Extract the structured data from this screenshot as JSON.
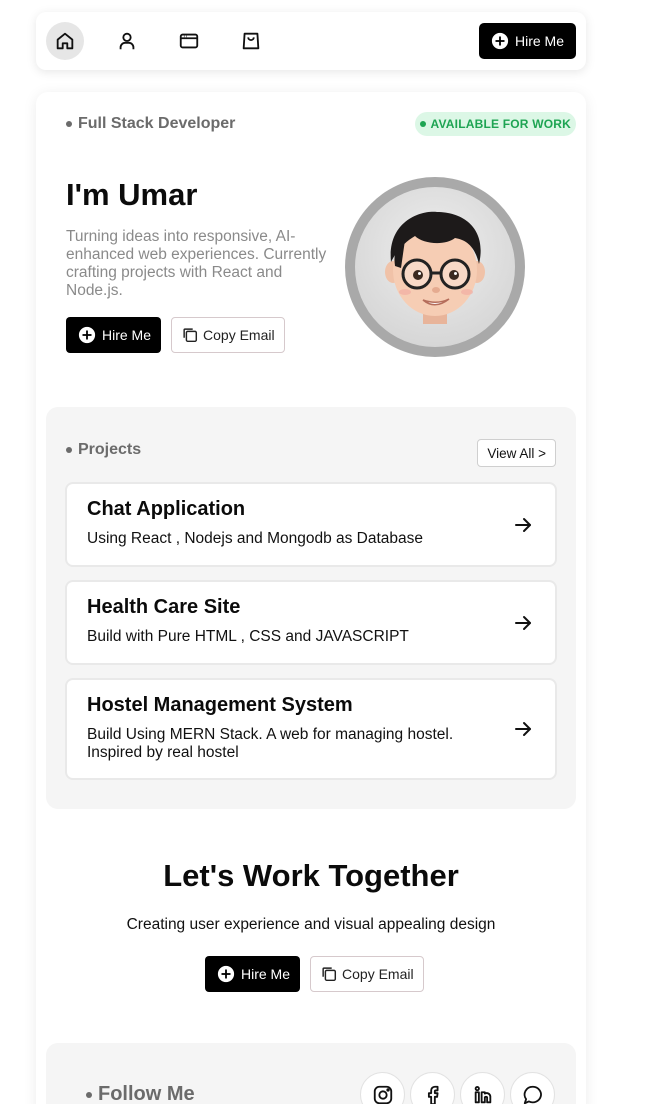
{
  "nav": {
    "icons": [
      "home-icon",
      "user-icon",
      "browser-window-icon",
      "shopping-bag-icon"
    ],
    "hire_label": "Hire Me"
  },
  "hero": {
    "role": "Full Stack Developer",
    "availability": "AVAILABLE FOR WORK",
    "title": "I'm Umar",
    "description": "Turning ideas into responsive, AI-enhanced web experiences. Currently crafting projects with React and Node.js.",
    "hire_label": "Hire Me",
    "copy_label": "Copy Email"
  },
  "projects": {
    "heading": "Projects",
    "view_all": "View All >",
    "items": [
      {
        "title": "Chat Application",
        "description": "Using React , Nodejs and Mongodb as Database"
      },
      {
        "title": "Health Care Site",
        "description": "Build with Pure HTML , CSS and JAVASCRIPT"
      },
      {
        "title": "Hostel Management System",
        "description": "Build Using MERN Stack. A web for managing hostel. Inspired by real hostel"
      }
    ]
  },
  "work": {
    "title": "Let's Work Together",
    "subtitle": "Creating user experience and visual appealing design",
    "hire_label": "Hire Me",
    "copy_label": "Copy Email"
  },
  "follow": {
    "heading": "Follow Me",
    "socials": [
      "instagram-icon",
      "facebook-icon",
      "linkedin-icon",
      "chat-icon"
    ]
  },
  "colors": {
    "accent_dark": "#000000",
    "available_bg": "#dcf7e6",
    "available_text": "#1ea453",
    "muted_text": "#6b6b6b"
  }
}
